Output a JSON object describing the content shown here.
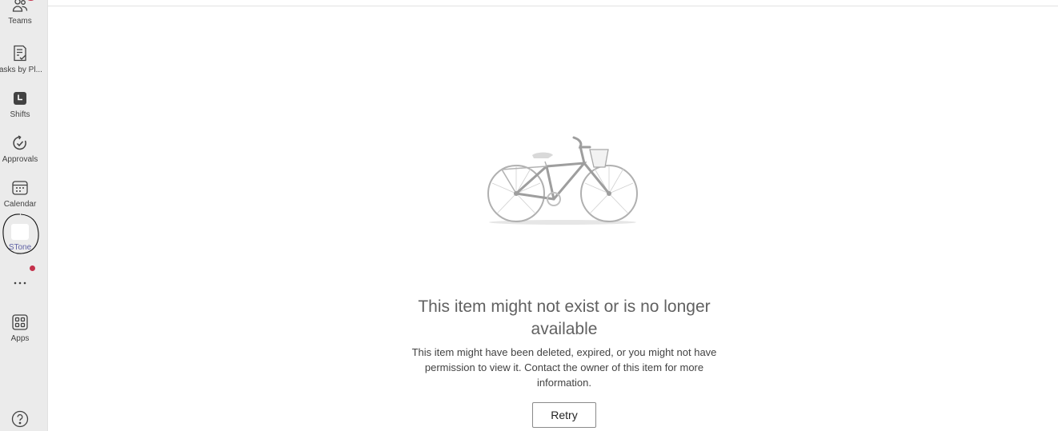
{
  "rail": {
    "items": [
      {
        "label": "Teams",
        "icon": "teams-icon",
        "badge": "@"
      },
      {
        "label": "Tasks by Pl...",
        "icon": "tasks-icon"
      },
      {
        "label": "Shifts",
        "icon": "shifts-icon"
      },
      {
        "label": "Approvals",
        "icon": "approvals-icon"
      },
      {
        "label": "Calendar",
        "icon": "calendar-icon"
      },
      {
        "label": "STone",
        "icon": "stone-app-icon"
      },
      {
        "label": "•••",
        "icon": "more-icon"
      },
      {
        "label": "Apps",
        "icon": "apps-icon"
      },
      {
        "label": "?",
        "icon": "help-icon"
      }
    ]
  },
  "colors": {
    "accent": "#6264a7",
    "badge": "#c4314b",
    "rail_bg": "#ebebeb"
  },
  "message": {
    "title": "This item might not exist or is no longer available",
    "description": "This item might have been deleted, expired, or you might not have permission to view it. Contact the owner of this item for more information.",
    "retry_label": "Retry",
    "illustration": "bicycle-illustration"
  }
}
